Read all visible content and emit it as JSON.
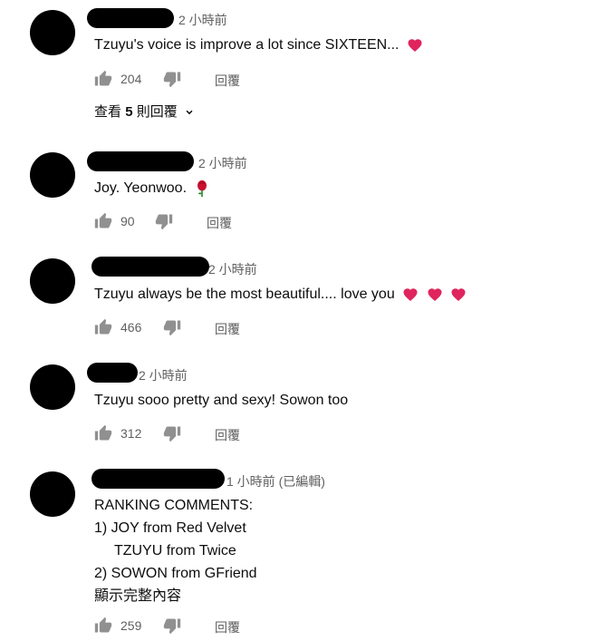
{
  "colors": {
    "text": "#0d0d0d",
    "meta": "#606060",
    "icon": "#909090",
    "heart": "#e0245e"
  },
  "comments": [
    {
      "time": "2 小時前",
      "text": "Tzuyu's voice is improve a lot since SIXTEEN...",
      "likes": "204",
      "reply_label": "回覆",
      "view_replies": {
        "prefix": "查看",
        "count": "5",
        "suffix": "則回覆"
      }
    },
    {
      "time": "2 小時前",
      "text": "Joy. Yeonwoo.",
      "likes": "90",
      "reply_label": "回覆"
    },
    {
      "time": "2 小時前",
      "text": "Tzuyu always be the most beautiful.... love you",
      "likes": "466",
      "reply_label": "回覆"
    },
    {
      "time": "2 小時前",
      "text": "Tzuyu sooo pretty and sexy! Sowon too",
      "likes": "312",
      "reply_label": "回覆"
    },
    {
      "time": "1 小時前 (已編輯)",
      "lines": [
        "RANKING COMMENTS:",
        "1) JOY from Red Velvet",
        "     TZUYU from Twice",
        "2) SOWON from GFriend"
      ],
      "show_more": "顯示完整內容",
      "likes": "259",
      "reply_label": "回覆"
    }
  ],
  "icons": {
    "like": "thumbs-up-icon",
    "dislike": "thumbs-down-icon",
    "expand": "chevron-down-icon",
    "heart": "heart-emoji-icon",
    "rose": "rose-emoji-icon"
  }
}
